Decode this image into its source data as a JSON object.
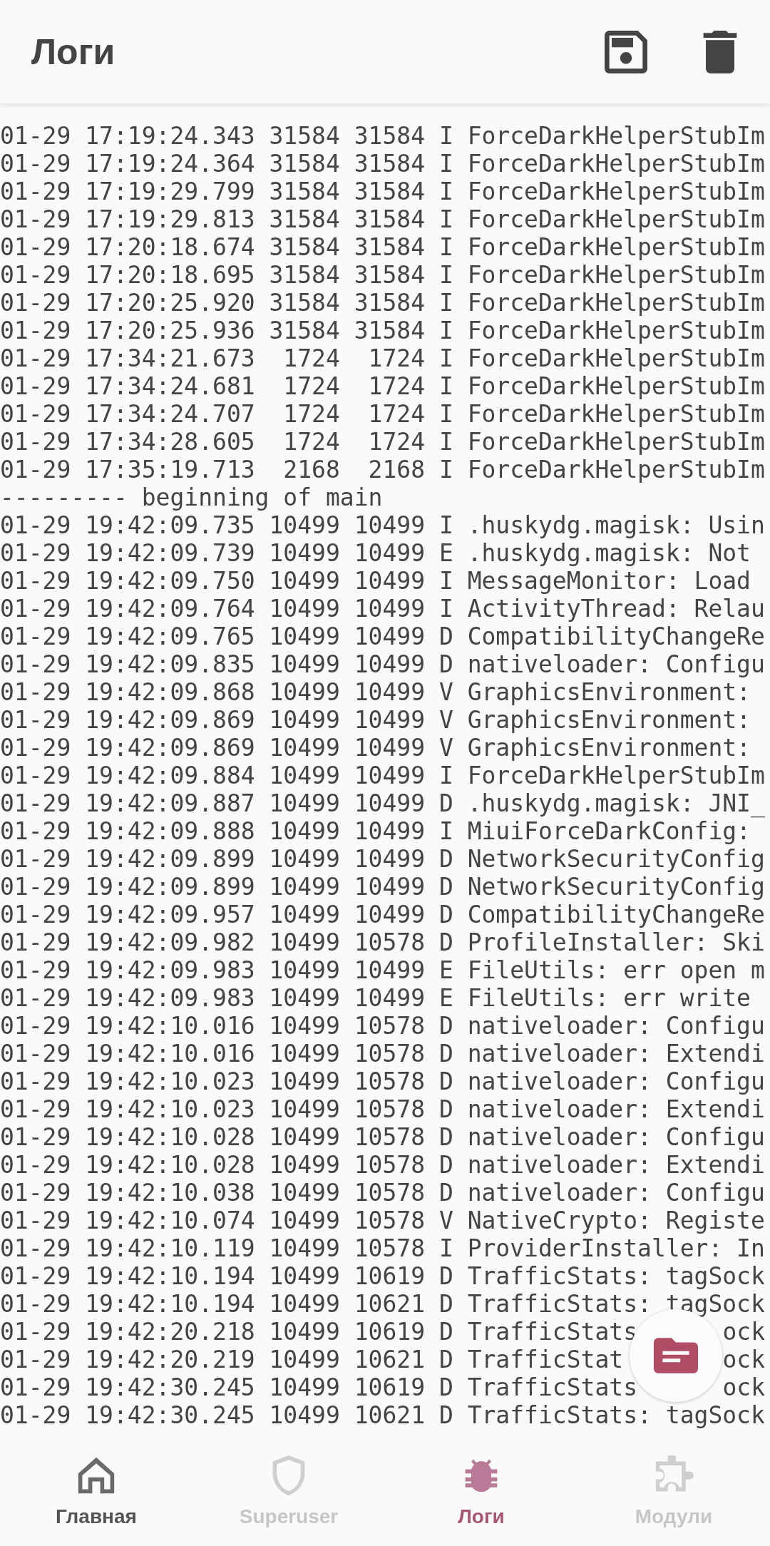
{
  "app_bar": {
    "title": "Логи"
  },
  "log_lines": [
    "01-29 17:19:24.343 31584 31584 I ForceDarkHelperStubIm",
    "01-29 17:19:24.364 31584 31584 I ForceDarkHelperStubIm",
    "01-29 17:19:29.799 31584 31584 I ForceDarkHelperStubIm",
    "01-29 17:19:29.813 31584 31584 I ForceDarkHelperStubIm",
    "01-29 17:20:18.674 31584 31584 I ForceDarkHelperStubIm",
    "01-29 17:20:18.695 31584 31584 I ForceDarkHelperStubIm",
    "01-29 17:20:25.920 31584 31584 I ForceDarkHelperStubIm",
    "01-29 17:20:25.936 31584 31584 I ForceDarkHelperStubIm",
    "01-29 17:34:21.673  1724  1724 I ForceDarkHelperStubIm",
    "01-29 17:34:24.681  1724  1724 I ForceDarkHelperStubIm",
    "01-29 17:34:24.707  1724  1724 I ForceDarkHelperStubIm",
    "01-29 17:34:28.605  1724  1724 I ForceDarkHelperStubIm",
    "01-29 17:35:19.713  2168  2168 I ForceDarkHelperStubIm",
    "--------- beginning of main",
    "01-29 19:42:09.735 10499 10499 I .huskydg.magisk: Usin",
    "01-29 19:42:09.739 10499 10499 E .huskydg.magisk: Not",
    "01-29 19:42:09.750 10499 10499 I MessageMonitor: Load",
    "01-29 19:42:09.764 10499 10499 I ActivityThread: Relau",
    "01-29 19:42:09.765 10499 10499 D CompatibilityChangeRe",
    "01-29 19:42:09.835 10499 10499 D nativeloader: Configu",
    "01-29 19:42:09.868 10499 10499 V GraphicsEnvironment:",
    "01-29 19:42:09.869 10499 10499 V GraphicsEnvironment:",
    "01-29 19:42:09.869 10499 10499 V GraphicsEnvironment:",
    "01-29 19:42:09.884 10499 10499 I ForceDarkHelperStubIm",
    "01-29 19:42:09.887 10499 10499 D .huskydg.magisk: JNI_",
    "01-29 19:42:09.888 10499 10499 I MiuiForceDarkConfig:",
    "01-29 19:42:09.899 10499 10499 D NetworkSecurityConfig",
    "01-29 19:42:09.899 10499 10499 D NetworkSecurityConfig",
    "01-29 19:42:09.957 10499 10499 D CompatibilityChangeRe",
    "01-29 19:42:09.982 10499 10578 D ProfileInstaller: Ski",
    "01-29 19:42:09.983 10499 10499 E FileUtils: err open m",
    "01-29 19:42:09.983 10499 10499 E FileUtils: err write",
    "01-29 19:42:10.016 10499 10578 D nativeloader: Configu",
    "01-29 19:42:10.016 10499 10578 D nativeloader: Extendi",
    "01-29 19:42:10.023 10499 10578 D nativeloader: Configu",
    "01-29 19:42:10.023 10499 10578 D nativeloader: Extendi",
    "01-29 19:42:10.028 10499 10578 D nativeloader: Configu",
    "01-29 19:42:10.028 10499 10578 D nativeloader: Extendi",
    "01-29 19:42:10.038 10499 10578 D nativeloader: Configu",
    "01-29 19:42:10.074 10499 10578 V NativeCrypto: Registe",
    "01-29 19:42:10.119 10499 10578 I ProviderInstaller: In",
    "01-29 19:42:10.194 10499 10619 D TrafficStats: tagSock",
    "01-29 19:42:10.194 10499 10621 D TrafficStats: tagSock",
    {
      "text": "01-29 19:42:20.218 10499 10619 D TrafficStats",
      "tail": "ock"
    },
    {
      "text": "01-29 19:42:20.219 10499 10621 D TrafficStat",
      "tail": "ock"
    },
    {
      "text": "01-29 19:42:30.245 10499 10619 D TrafficStats",
      "tail": "ock"
    },
    "01-29 19:42:30.245 10499 10621 D TrafficStats: tagSock"
  ],
  "bottom_nav": [
    {
      "label": "Главная",
      "kind": "home",
      "selected": false,
      "disabled": false
    },
    {
      "label": "Superuser",
      "kind": "superuser",
      "selected": false,
      "disabled": true
    },
    {
      "label": "Логи",
      "kind": "logs",
      "selected": true,
      "disabled": false
    },
    {
      "label": "Модули",
      "kind": "modules",
      "selected": false,
      "disabled": true
    }
  ]
}
